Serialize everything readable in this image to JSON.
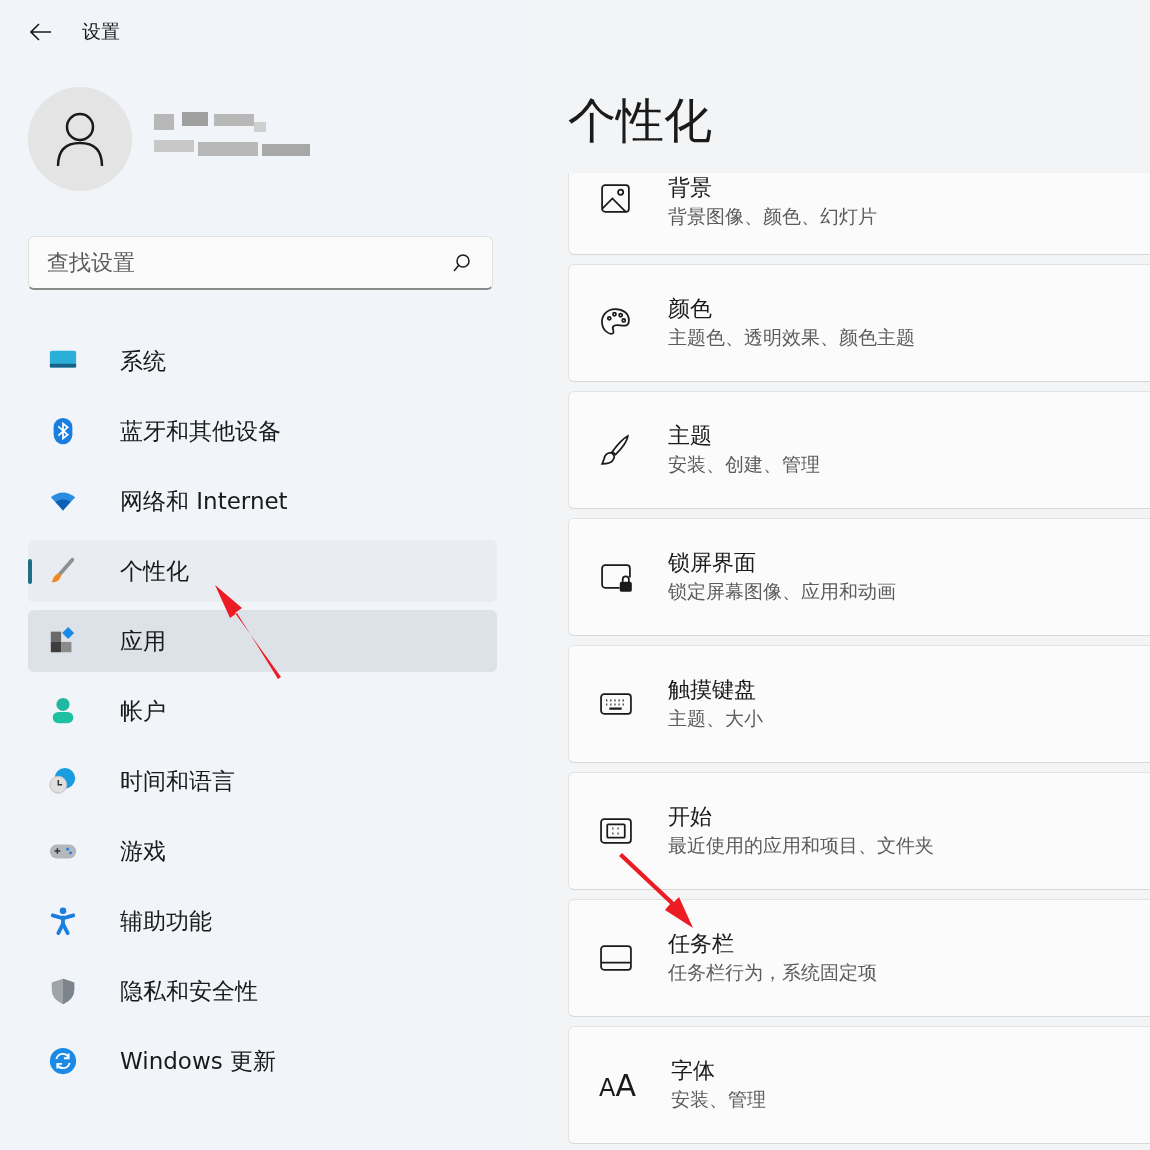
{
  "window": {
    "title": "设置"
  },
  "search": {
    "placeholder": "查找设置"
  },
  "nav_items": [
    {
      "label": "系统",
      "selected": false,
      "hovered": false
    },
    {
      "label": "蓝牙和其他设备",
      "selected": false,
      "hovered": false
    },
    {
      "label": "网络和 Internet",
      "selected": false,
      "hovered": false
    },
    {
      "label": "个性化",
      "selected": true,
      "hovered": false
    },
    {
      "label": "应用",
      "selected": false,
      "hovered": true
    },
    {
      "label": "帐户",
      "selected": false,
      "hovered": false
    },
    {
      "label": "时间和语言",
      "selected": false,
      "hovered": false
    },
    {
      "label": "游戏",
      "selected": false,
      "hovered": false
    },
    {
      "label": "辅助功能",
      "selected": false,
      "hovered": false
    },
    {
      "label": "隐私和安全性",
      "selected": false,
      "hovered": false
    },
    {
      "label": "Windows 更新",
      "selected": false,
      "hovered": false
    }
  ],
  "page_title": "个性化",
  "cards": [
    {
      "kind": "icon",
      "title": "背景",
      "subtitle": "背景图像、颜色、幻灯片"
    },
    {
      "kind": "icon",
      "title": "颜色",
      "subtitle": "主题色、透明效果、颜色主题"
    },
    {
      "kind": "icon",
      "title": "主题",
      "subtitle": "安装、创建、管理"
    },
    {
      "kind": "icon",
      "title": "锁屏界面",
      "subtitle": "锁定屏幕图像、应用和动画"
    },
    {
      "kind": "icon",
      "title": "触摸键盘",
      "subtitle": "主题、大小"
    },
    {
      "kind": "icon",
      "title": "开始",
      "subtitle": "最近使用的应用和项目、文件夹"
    },
    {
      "kind": "icon",
      "title": "任务栏",
      "subtitle": "任务栏行为，系统固定项"
    },
    {
      "kind": "glyph",
      "glyph": "AA",
      "title": "字体",
      "subtitle": "安装、管理"
    }
  ]
}
